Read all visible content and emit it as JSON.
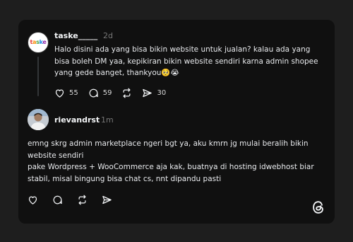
{
  "post": {
    "username": "taske_____",
    "time": "2d",
    "avatar_text": "taske",
    "lines": [
      "Halo disini ada yang bisa bikin website untuk jualan? kalau ada yang",
      "bisa boleh DM yaa, kepikiran bikin website sendiri karna admin shopee",
      "yang gede banget, thankyou🥺😭"
    ],
    "likes": "55",
    "comments": "59",
    "shares": "30"
  },
  "reply": {
    "username": "rievandrst",
    "time": "1m",
    "lines": [
      "emng skrg admin marketplace ngeri bgt ya, aku kmrn jg mulai beralih bikin",
      "website sendiri",
      "pake Wordpress + WooCommerce aja kak, buatnya di hosting idwebhost biar",
      "stabil, misal bingung bisa chat cs, nnt dipandu pasti"
    ]
  },
  "icons": {
    "like": "heart-icon",
    "comment": "comment-icon",
    "repost": "repost-icon",
    "share": "send-icon",
    "brand": "threads-logo-icon"
  },
  "colors": {
    "background": "#1e1e1e",
    "card": "#101010",
    "text": "#f3f5f7",
    "muted": "#777777"
  }
}
